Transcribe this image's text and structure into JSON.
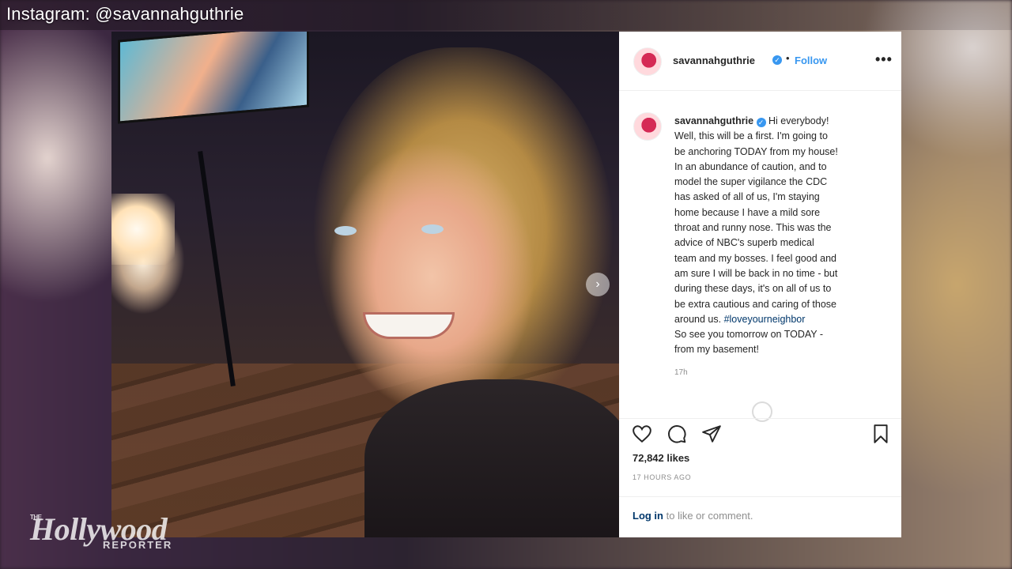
{
  "overlay": {
    "caption": "Instagram: @savannahguthrie",
    "watermark": {
      "the": "THE",
      "name": "Hollywood",
      "sub": "REPORTER"
    }
  },
  "post": {
    "username": "savannahguthrie",
    "follow_label": "Follow",
    "dot": "•",
    "more_label": "•••",
    "carousel_indicator": "›",
    "caption_lines": [
      "Hi everybody!",
      "Well, this will be a first. I'm going to",
      "be anchoring TODAY from my house!",
      "In an abundance of caution, and to",
      "model the super vigilance the CDC",
      "has asked of all of us, I'm staying",
      "home because I have a mild sore",
      "throat and runny nose. This was the",
      "advice of NBC's superb medical",
      "team and my bosses. I feel good and",
      "am sure I will be back in no time - but",
      "during these days, it's on all of us to",
      "be extra cautious and caring of those",
      "around us."
    ],
    "hashtag": "#loveyourneighbor",
    "caption_end": [
      "So see you tomorrow on TODAY -",
      "from my basement!"
    ],
    "caption_time": "17h",
    "likes": "72,842 likes",
    "posted_ago": "17 HOURS AGO",
    "login_link": "Log in",
    "login_rest": " to like or comment."
  },
  "icons": [
    "heart-icon",
    "comment-icon",
    "share-icon",
    "bookmark-icon",
    "verified-badge-icon",
    "more-icon"
  ],
  "colors": {
    "follow_blue": "#3897f0",
    "link_dark": "#00376b",
    "text": "#262626",
    "muted": "#8e8e8e"
  }
}
